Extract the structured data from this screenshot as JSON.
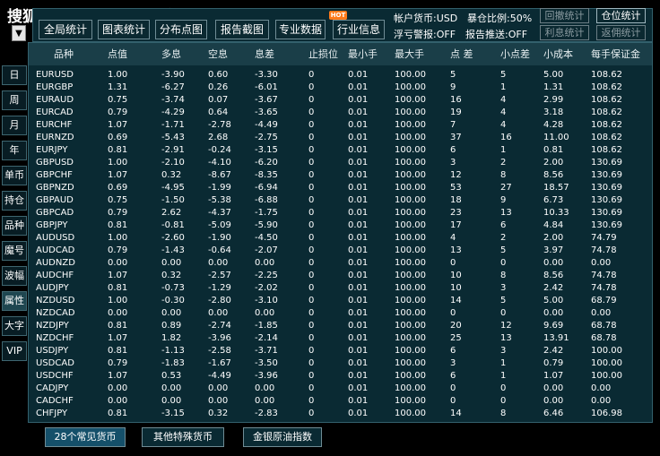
{
  "title": "搜狐号@人人汇数据导航",
  "hot_badge": "HOT",
  "toolbar": {
    "dropdown_icon": "▼",
    "buttons": [
      "全局统计",
      "图表统计",
      "分布点图",
      "报告截图",
      "专业数据",
      "行业信息"
    ],
    "account_currency": "帐户货币:USD",
    "exposure": "暴仓比例:50%",
    "float_alert": "浮亏警报:OFF",
    "report_push": "报告推送:OFF",
    "right_buttons": [
      "回撤统计",
      "仓位统计",
      "利息统计",
      "返佣统计"
    ]
  },
  "sidebar": [
    "日",
    "周",
    "月",
    "年",
    "单币",
    "持仓",
    "品种",
    "魔号",
    "波幅",
    "属性",
    "大字",
    "VIP"
  ],
  "sidebar_active_index": 9,
  "table": {
    "headers": [
      "品种",
      "点值",
      "多息",
      "空息",
      "息差",
      "止损位",
      "最小手",
      "最大手",
      "点 差",
      "小点差",
      "小成本",
      "每手保证金"
    ],
    "rows": [
      [
        "EURUSD",
        "1.00",
        "-3.90",
        "0.60",
        "-3.30",
        "0",
        "0.01",
        "100.00",
        "5",
        "5",
        "5.00",
        "108.62"
      ],
      [
        "EURGBP",
        "1.31",
        "-6.27",
        "0.26",
        "-6.01",
        "0",
        "0.01",
        "100.00",
        "9",
        "1",
        "1.31",
        "108.62"
      ],
      [
        "EURAUD",
        "0.75",
        "-3.74",
        "0.07",
        "-3.67",
        "0",
        "0.01",
        "100.00",
        "16",
        "4",
        "2.99",
        "108.62"
      ],
      [
        "EURCAD",
        "0.79",
        "-4.29",
        "0.64",
        "-3.65",
        "0",
        "0.01",
        "100.00",
        "19",
        "4",
        "3.18",
        "108.62"
      ],
      [
        "EURCHF",
        "1.07",
        "-1.71",
        "-2.78",
        "-4.49",
        "0",
        "0.01",
        "100.00",
        "7",
        "4",
        "4.28",
        "108.62"
      ],
      [
        "EURNZD",
        "0.69",
        "-5.43",
        "2.68",
        "-2.75",
        "0",
        "0.01",
        "100.00",
        "37",
        "16",
        "11.00",
        "108.62"
      ],
      [
        "EURJPY",
        "0.81",
        "-2.91",
        "-0.24",
        "-3.15",
        "0",
        "0.01",
        "100.00",
        "6",
        "1",
        "0.81",
        "108.62"
      ],
      [
        "GBPUSD",
        "1.00",
        "-2.10",
        "-4.10",
        "-6.20",
        "0",
        "0.01",
        "100.00",
        "3",
        "2",
        "2.00",
        "130.69"
      ],
      [
        "GBPCHF",
        "1.07",
        "0.32",
        "-8.67",
        "-8.35",
        "0",
        "0.01",
        "100.00",
        "12",
        "8",
        "8.56",
        "130.69"
      ],
      [
        "GBPNZD",
        "0.69",
        "-4.95",
        "-1.99",
        "-6.94",
        "0",
        "0.01",
        "100.00",
        "53",
        "27",
        "18.57",
        "130.69"
      ],
      [
        "GBPAUD",
        "0.75",
        "-1.50",
        "-5.38",
        "-6.88",
        "0",
        "0.01",
        "100.00",
        "18",
        "9",
        "6.73",
        "130.69"
      ],
      [
        "GBPCAD",
        "0.79",
        "2.62",
        "-4.37",
        "-1.75",
        "0",
        "0.01",
        "100.00",
        "23",
        "13",
        "10.33",
        "130.69"
      ],
      [
        "GBPJPY",
        "0.81",
        "-0.81",
        "-5.09",
        "-5.90",
        "0",
        "0.01",
        "100.00",
        "17",
        "6",
        "4.84",
        "130.69"
      ],
      [
        "AUDUSD",
        "1.00",
        "-2.60",
        "-1.90",
        "-4.50",
        "0",
        "0.01",
        "100.00",
        "4",
        "2",
        "2.00",
        "74.79"
      ],
      [
        "AUDCAD",
        "0.79",
        "-1.43",
        "-0.64",
        "-2.07",
        "0",
        "0.01",
        "100.00",
        "13",
        "5",
        "3.97",
        "74.78"
      ],
      [
        "AUDNZD",
        "0.00",
        "0.00",
        "0.00",
        "0.00",
        "0",
        "0.01",
        "100.00",
        "0",
        "0",
        "0.00",
        "0.00"
      ],
      [
        "AUDCHF",
        "1.07",
        "0.32",
        "-2.57",
        "-2.25",
        "0",
        "0.01",
        "100.00",
        "10",
        "8",
        "8.56",
        "74.78"
      ],
      [
        "AUDJPY",
        "0.81",
        "-0.73",
        "-1.29",
        "-2.02",
        "0",
        "0.01",
        "100.00",
        "10",
        "3",
        "2.42",
        "74.78"
      ],
      [
        "NZDUSD",
        "1.00",
        "-0.30",
        "-2.80",
        "-3.10",
        "0",
        "0.01",
        "100.00",
        "14",
        "5",
        "5.00",
        "68.79"
      ],
      [
        "NZDCAD",
        "0.00",
        "0.00",
        "0.00",
        "0.00",
        "0",
        "0.01",
        "100.00",
        "0",
        "0",
        "0.00",
        "0.00"
      ],
      [
        "NZDJPY",
        "0.81",
        "0.89",
        "-2.74",
        "-1.85",
        "0",
        "0.01",
        "100.00",
        "20",
        "12",
        "9.69",
        "68.78"
      ],
      [
        "NZDCHF",
        "1.07",
        "1.82",
        "-3.96",
        "-2.14",
        "0",
        "0.01",
        "100.00",
        "25",
        "13",
        "13.91",
        "68.78"
      ],
      [
        "USDJPY",
        "0.81",
        "-1.13",
        "-2.58",
        "-3.71",
        "0",
        "0.01",
        "100.00",
        "6",
        "3",
        "2.42",
        "100.00"
      ],
      [
        "USDCAD",
        "0.79",
        "-1.83",
        "-1.67",
        "-3.50",
        "0",
        "0.01",
        "100.00",
        "3",
        "1",
        "0.79",
        "100.00"
      ],
      [
        "USDCHF",
        "1.07",
        "0.53",
        "-4.49",
        "-3.96",
        "0",
        "0.01",
        "100.00",
        "6",
        "1",
        "1.07",
        "100.00"
      ],
      [
        "CADJPY",
        "0.00",
        "0.00",
        "0.00",
        "0.00",
        "0",
        "0.01",
        "100.00",
        "0",
        "0",
        "0.00",
        "0.00"
      ],
      [
        "CADCHF",
        "0.00",
        "0.00",
        "0.00",
        "0.00",
        "0",
        "0.01",
        "100.00",
        "0",
        "0",
        "0.00",
        "0.00"
      ],
      [
        "CHFJPY",
        "0.81",
        "-3.15",
        "0.32",
        "-2.83",
        "0",
        "0.01",
        "100.00",
        "14",
        "8",
        "6.46",
        "106.98"
      ]
    ]
  },
  "bottom_tabs": [
    "28个常见货币",
    "其他特殊货币",
    "金银原油指数"
  ],
  "bottom_active_index": 0
}
